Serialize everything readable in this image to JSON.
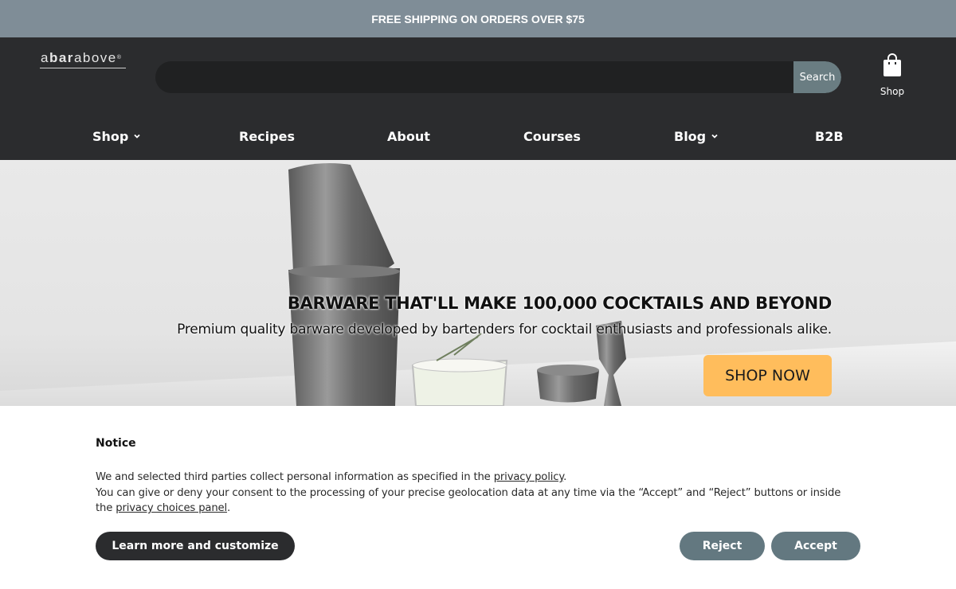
{
  "promo": {
    "text": "FREE SHIPPING ON ORDERS OVER $75"
  },
  "header": {
    "logo": {
      "text_a": "a",
      "text_bar": "bar",
      "text_above": "above",
      "tm": "®"
    },
    "search": {
      "placeholder": "",
      "value": "",
      "button_label": "Search"
    },
    "cart": {
      "icon": "shopping-bag-icon",
      "label": "Shop"
    }
  },
  "nav": {
    "items": [
      {
        "label": "Shop",
        "has_dropdown": true
      },
      {
        "label": "Recipes",
        "has_dropdown": false
      },
      {
        "label": "About",
        "has_dropdown": false
      },
      {
        "label": "Courses",
        "has_dropdown": false
      },
      {
        "label": "Blog",
        "has_dropdown": true
      },
      {
        "label": "B2B",
        "has_dropdown": false
      }
    ]
  },
  "hero": {
    "title": "BARWARE THAT'LL MAKE 100,000 COCKTAILS AND BEYOND",
    "subtitle": "Premium quality barware developed by bartenders for cocktail enthusiasts and professionals alike.",
    "cta_label": "SHOP NOW"
  },
  "notice": {
    "title": "Notice",
    "line1_prefix": "We and selected third parties collect personal information as specified in the ",
    "privacy_policy_link": "privacy policy",
    "line1_suffix": ".",
    "line2_prefix": "You can give or deny your consent to the processing of your precise geolocation data at any time via the “Accept” and “Reject” buttons or inside the ",
    "privacy_choices_link": "privacy choices panel",
    "line2_suffix": ".",
    "learn_more_label": "Learn more and customize",
    "reject_label": "Reject",
    "accept_label": "Accept"
  },
  "colors": {
    "promo_bg": "#7f8d97",
    "header_bg": "#2b2c2e",
    "search_button_bg": "#6a7d82",
    "cta_bg": "#ffbd5c",
    "consent_button_bg": "#637880"
  }
}
